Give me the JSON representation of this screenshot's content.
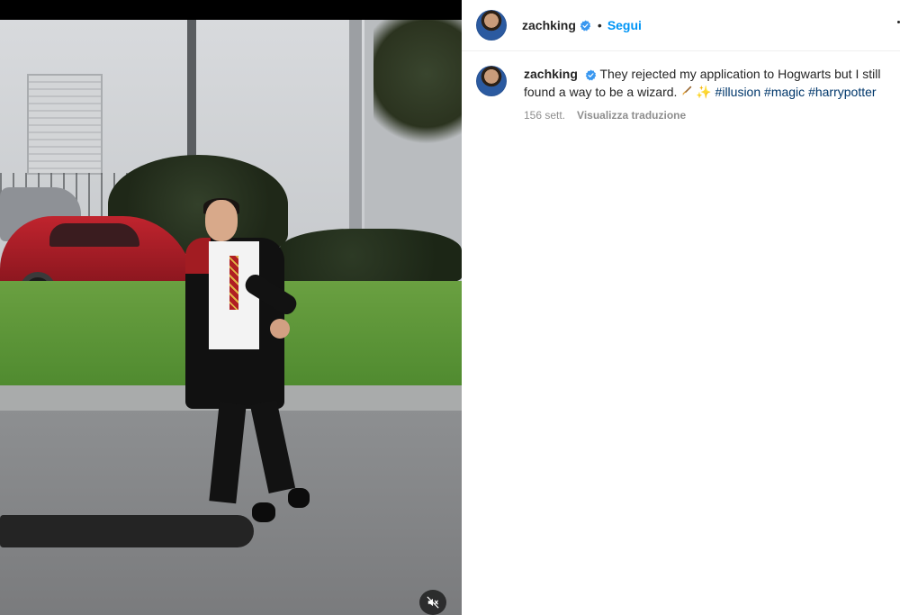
{
  "post": {
    "username": "zachking",
    "separator": "•",
    "follow_label": "Segui",
    "caption_text": "They rejected my application to Hogwarts but I still found a way to be a wizard.",
    "caption_emoji_sparkles": "✨",
    "hashtags": [
      "#illusion",
      "#magic",
      "#harrypotter"
    ],
    "timestamp": "156 sett.",
    "translate_label": "Visualizza traduzione"
  },
  "colors": {
    "follow_blue": "#0095f6",
    "hashtag": "#00376b",
    "verified_blue": "#3897f0",
    "meta_grey": "#8e8e8e"
  },
  "icons": {
    "verified": "verified-badge-icon",
    "more": "more-options-icon",
    "mute": "audio-muted-icon",
    "broom": "broom-emoji",
    "sparkles": "sparkles-emoji"
  }
}
